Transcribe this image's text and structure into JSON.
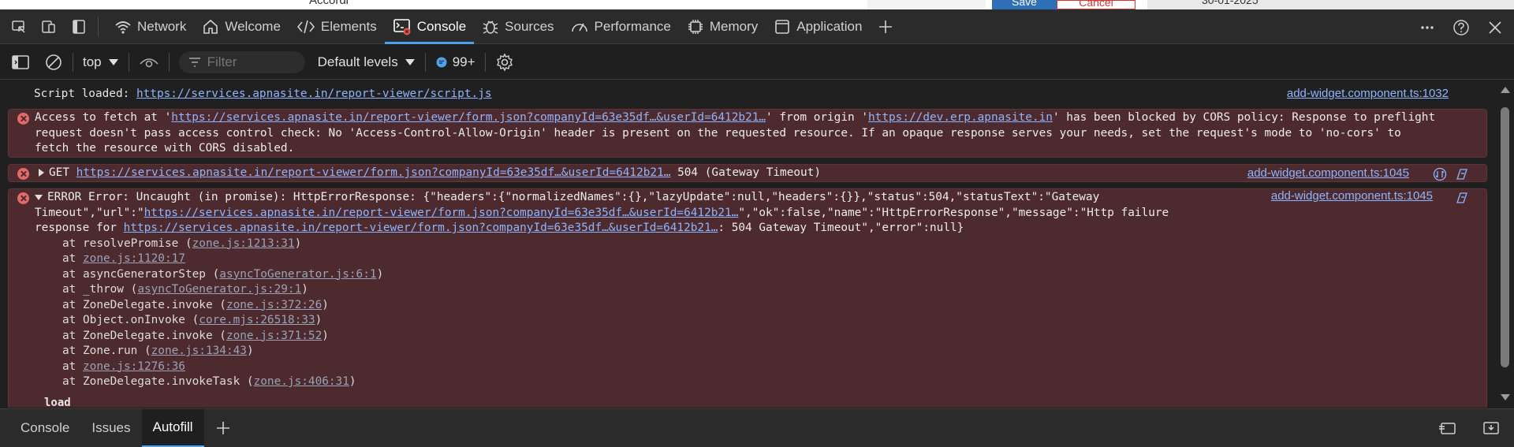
{
  "page_behind": {
    "fragment_text": "Accordi",
    "save_label": "Save",
    "cancel_label": "Cancel",
    "date_text": "30-01-2025"
  },
  "tabs": [
    {
      "label": "Network",
      "icon": "wifi-icon"
    },
    {
      "label": "Welcome",
      "icon": "home-icon"
    },
    {
      "label": "Elements",
      "icon": "code-brackets-icon"
    },
    {
      "label": "Console",
      "icon": "console-icon",
      "active": true
    },
    {
      "label": "Sources",
      "icon": "bug-icon"
    },
    {
      "label": "Performance",
      "icon": "gauge-icon"
    },
    {
      "label": "Memory",
      "icon": "chip-icon"
    },
    {
      "label": "Application",
      "icon": "window-icon"
    }
  ],
  "toolbar": {
    "context": "top",
    "filter_placeholder": "Filter",
    "levels": "Default levels",
    "message_count": "99+"
  },
  "messages": {
    "info": {
      "prefix": "Script loaded: ",
      "url": "https://services.apnasite.in/report-viewer/script.js",
      "source": "add-widget.component.ts:1032"
    },
    "cors": {
      "p1": "Access to fetch at '",
      "url": "https://services.apnasite.in/report-viewer/form.json?companyId=63e35df…&userId=6412b21…",
      "p2": "' from origin '",
      "origin": "https://dev.erp.apnasite.in",
      "p3": "' has been blocked by CORS policy: Response to preflight request doesn't pass access control check: No 'Access-Control-Allow-Origin' header is present on the requested resource. If an opaque response serves your needs, set the request's mode to 'no-cors' to fetch the resource with CORS disabled."
    },
    "get": {
      "method": "GET ",
      "url": "https://services.apnasite.in/report-viewer/form.json?companyId=63e35df…&userId=6412b21…",
      "status": " 504 (Gateway Timeout)",
      "source": "add-widget.component.ts:1045"
    },
    "error": {
      "p1": "ERROR Error: Uncaught (in promise): HttpErrorResponse: {\"headers\":{\"normalizedNames\":{},\"lazyUpdate\":null,\"headers\":{}},\"status\":504,\"statusText\":\"Gateway Timeout\",\"url\":\"",
      "url1": "https://services.apnasite.in/report-viewer/form.json?companyId=63e35df…&userId=6412b21…",
      "p2": "\",\"ok\":false,\"name\":\"HttpErrorResponse\",\"message\":\"Http failure response for ",
      "url2": "https://services.apnasite.in/report-viewer/form.json?companyId=63e35df…&userId=6412b21…",
      "p3": ": 504 Gateway Timeout\",\"error\":null}",
      "source": "add-widget.component.ts:1045",
      "stack": [
        {
          "fn": "at resolvePromise (",
          "loc": "zone.js:1213:31",
          "end": ")"
        },
        {
          "fn": "at ",
          "loc": "zone.js:1120:17",
          "end": ""
        },
        {
          "fn": "at asyncGeneratorStep (",
          "loc": "asyncToGenerator.js:6:1",
          "end": ")"
        },
        {
          "fn": "at _throw (",
          "loc": "asyncToGenerator.js:29:1",
          "end": ")"
        },
        {
          "fn": "at ZoneDelegate.invoke (",
          "loc": "zone.js:372:26",
          "end": ")"
        },
        {
          "fn": "at Object.onInvoke (",
          "loc": "core.mjs:26518:33",
          "end": ")"
        },
        {
          "fn": "at ZoneDelegate.invoke (",
          "loc": "zone.js:371:52",
          "end": ")"
        },
        {
          "fn": "at Zone.run (",
          "loc": "zone.js:134:43",
          "end": ")"
        },
        {
          "fn": "at ",
          "loc": "zone.js:1276:36",
          "end": ""
        },
        {
          "fn": "at ZoneDelegate.invokeTask (",
          "loc": "zone.js:406:31",
          "end": ")"
        }
      ]
    },
    "partial_label": "load"
  },
  "drawer": {
    "tabs": [
      "Console",
      "Issues",
      "Autofill"
    ]
  },
  "colors": {
    "accent": "#4ba3f0",
    "error_bg": "#4d2a2d",
    "link": "#8db5ff"
  }
}
